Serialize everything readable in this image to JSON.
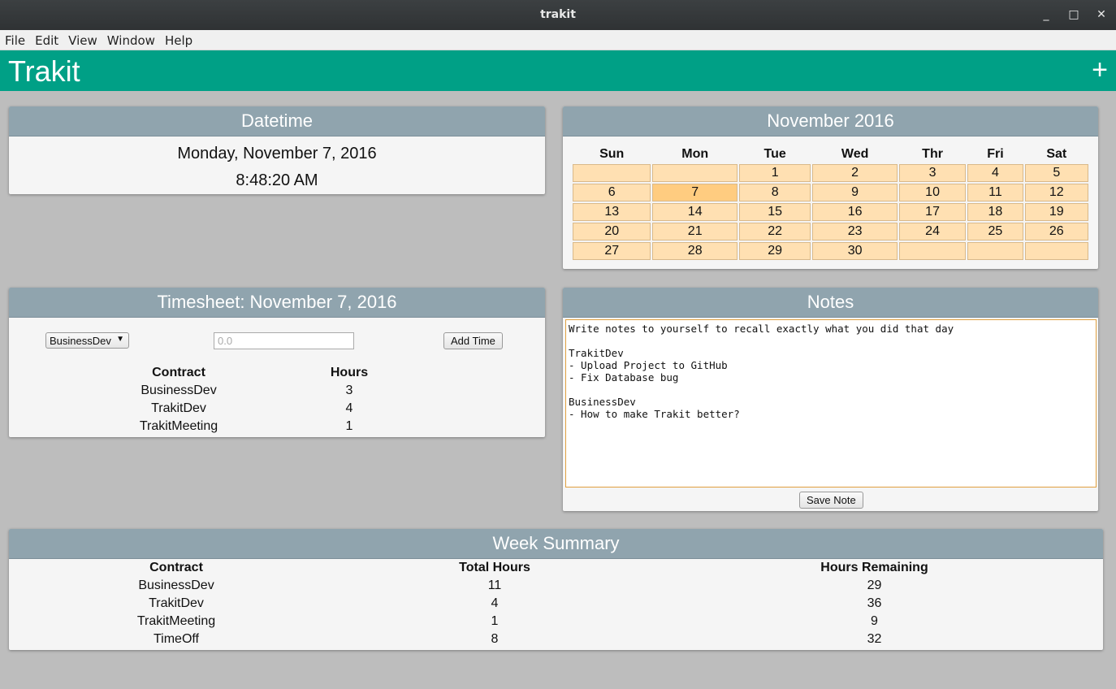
{
  "window": {
    "title": "trakit",
    "minimize": "_",
    "maximize": "□",
    "close": "✕"
  },
  "menu": [
    "File",
    "Edit",
    "View",
    "Window",
    "Help"
  ],
  "app": {
    "brand": "Trakit",
    "add": "+"
  },
  "datetime": {
    "heading": "Datetime",
    "date": "Monday, November 7, 2016",
    "time": "8:48:20 AM"
  },
  "calendar": {
    "heading": "November 2016",
    "days": [
      "Sun",
      "Mon",
      "Tue",
      "Wed",
      "Thr",
      "Fri",
      "Sat"
    ],
    "weeks": [
      [
        "",
        "",
        "1",
        "2",
        "3",
        "4",
        "5"
      ],
      [
        "6",
        "7",
        "8",
        "9",
        "10",
        "11",
        "12"
      ],
      [
        "13",
        "14",
        "15",
        "16",
        "17",
        "18",
        "19"
      ],
      [
        "20",
        "21",
        "22",
        "23",
        "24",
        "25",
        "26"
      ],
      [
        "27",
        "28",
        "29",
        "30",
        "",
        "",
        ""
      ]
    ],
    "today": "7"
  },
  "timesheet": {
    "heading": "Timesheet: November 7, 2016",
    "selected_contract": "BusinessDev",
    "hours_placeholder": "0.0",
    "add_label": "Add Time",
    "columns": [
      "Contract",
      "Hours"
    ],
    "rows": [
      [
        "BusinessDev",
        "3"
      ],
      [
        "TrakitDev",
        "4"
      ],
      [
        "TrakitMeeting",
        "1"
      ]
    ]
  },
  "notes": {
    "heading": "Notes",
    "text": "Write notes to yourself to recall exactly what you did that day\n\nTrakitDev\n- Upload Project to GitHub\n- Fix Database bug\n\nBusinessDev\n- How to make Trakit better?",
    "save_label": "Save Note"
  },
  "week": {
    "heading": "Week Summary",
    "columns": [
      "Contract",
      "Total Hours",
      "Hours Remaining"
    ],
    "rows": [
      [
        "BusinessDev",
        "11",
        "29"
      ],
      [
        "TrakitDev",
        "4",
        "36"
      ],
      [
        "TrakitMeeting",
        "1",
        "9"
      ],
      [
        "TimeOff",
        "8",
        "32"
      ]
    ]
  }
}
